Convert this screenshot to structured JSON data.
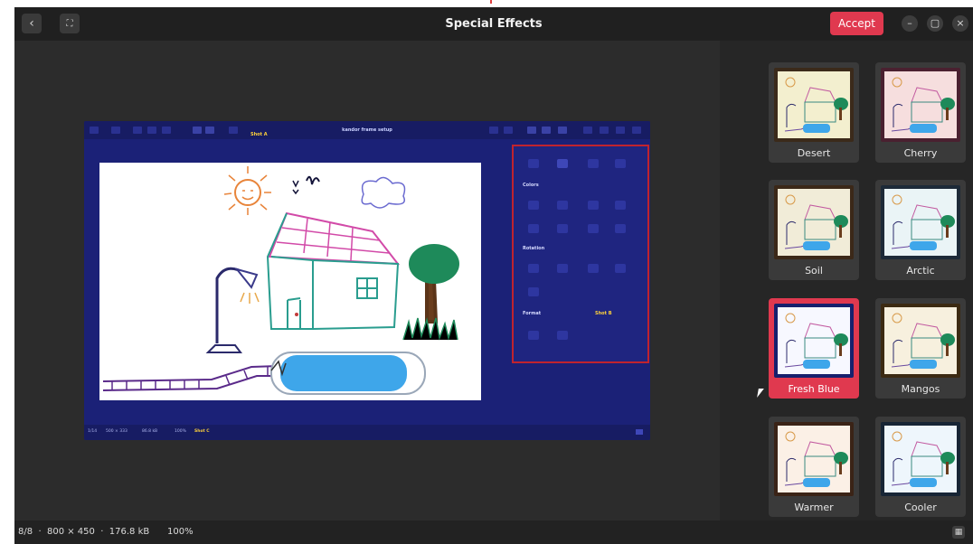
{
  "header": {
    "title": "Special Effects",
    "accept_label": "Accept",
    "back_icon": "chevron-left-icon",
    "fullscreen_icon": "fullscreen-icon",
    "minimize_icon": "minimize-icon",
    "maximize_icon": "maximize-icon",
    "close_icon": "close-icon"
  },
  "preview": {
    "title": "kandor frame setup",
    "tag_top": "Shot A",
    "tag_panel": "Shot B",
    "tag_status": "Shot C",
    "panel_sections": [
      "Colors",
      "Rotation",
      "Format"
    ],
    "status_items": [
      "1/14",
      "500 × 333",
      "86.8 kB",
      "100%"
    ]
  },
  "effects": [
    {
      "label": "Desert",
      "frame": "#3b2a1a",
      "tint": "#f3efcf",
      "selected": false
    },
    {
      "label": "Cherry",
      "frame": "#4a2030",
      "tint": "#f6dede",
      "selected": false
    },
    {
      "label": "Soil",
      "frame": "#3b2818",
      "tint": "#f1ecd8",
      "selected": false
    },
    {
      "label": "Arctic",
      "frame": "#1d2a38",
      "tint": "#eaf4f6",
      "selected": false
    },
    {
      "label": "Fresh Blue",
      "frame": "#16206d",
      "tint": "#f7f8ff",
      "selected": true
    },
    {
      "label": "Mangos",
      "frame": "#3c2a12",
      "tint": "#f7f0de",
      "selected": false
    },
    {
      "label": "Warmer",
      "frame": "#3a2316",
      "tint": "#fbf0e6",
      "selected": false
    },
    {
      "label": "Cooler",
      "frame": "#172535",
      "tint": "#eef6fc",
      "selected": false
    }
  ],
  "statusbar": {
    "info": "8/8  ·  800 × 450  ·  176.8 kB",
    "zoom": "100%",
    "button_icon": "grid-icon"
  },
  "colors": {
    "accent": "#e0394f",
    "panel_border": "#c0232e",
    "preview_bg": "#1b2177"
  }
}
